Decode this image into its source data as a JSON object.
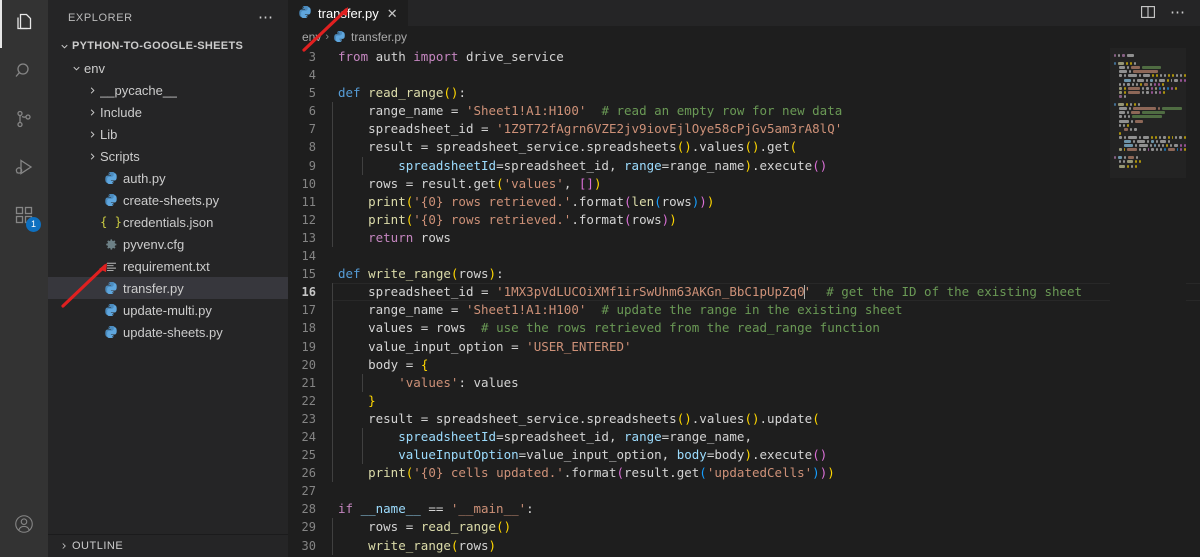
{
  "activitybar": {
    "items": [
      {
        "name": "explorer",
        "icon": "files-icon",
        "active": true,
        "badge": ""
      },
      {
        "name": "search",
        "icon": "search-icon",
        "active": false,
        "badge": ""
      },
      {
        "name": "source-control",
        "icon": "source-control-icon",
        "active": false,
        "badge": ""
      },
      {
        "name": "run-and-debug",
        "icon": "run-debug-icon",
        "active": false,
        "badge": ""
      },
      {
        "name": "extensions",
        "icon": "extensions-icon",
        "active": false,
        "badge": "1"
      }
    ],
    "accounts_icon": "account-icon"
  },
  "sidebar": {
    "title": "EXPLORER",
    "more_actions": "⋯",
    "root": {
      "label": "PYTHON-TO-GOOGLE-SHEETS",
      "expanded": true
    },
    "tree": [
      {
        "label": "env",
        "kind": "folder",
        "expanded": true,
        "indent": 1,
        "icon": "chevron-down-icon"
      },
      {
        "label": "__pycache__",
        "kind": "folder",
        "expanded": false,
        "indent": 2,
        "icon": "chevron-right-icon"
      },
      {
        "label": "Include",
        "kind": "folder",
        "expanded": false,
        "indent": 2,
        "icon": "chevron-right-icon"
      },
      {
        "label": "Lib",
        "kind": "folder",
        "expanded": false,
        "indent": 2,
        "icon": "chevron-right-icon"
      },
      {
        "label": "Scripts",
        "kind": "folder",
        "expanded": false,
        "indent": 2,
        "icon": "chevron-right-icon"
      },
      {
        "label": "auth.py",
        "kind": "python",
        "indent": 2,
        "icon": "python-file-icon"
      },
      {
        "label": "create-sheets.py",
        "kind": "python",
        "indent": 2,
        "icon": "python-file-icon"
      },
      {
        "label": "credentials.json",
        "kind": "json",
        "indent": 2,
        "icon": "json-file-icon"
      },
      {
        "label": "pyvenv.cfg",
        "kind": "config",
        "indent": 2,
        "icon": "gear-icon"
      },
      {
        "label": "requirement.txt",
        "kind": "text",
        "indent": 2,
        "icon": "text-file-icon"
      },
      {
        "label": "transfer.py",
        "kind": "python",
        "indent": 2,
        "icon": "python-file-icon",
        "selected": true
      },
      {
        "label": "update-multi.py",
        "kind": "python",
        "indent": 2,
        "icon": "python-file-icon"
      },
      {
        "label": "update-sheets.py",
        "kind": "python",
        "indent": 2,
        "icon": "python-file-icon"
      }
    ],
    "footer": {
      "label": "OUTLINE",
      "icon": "chevron-right-icon"
    }
  },
  "editor": {
    "tabs": [
      {
        "label": "transfer.py",
        "icon": "python-file-icon",
        "active": true,
        "close": "✕"
      }
    ],
    "actions": [
      {
        "name": "split-editor-right-button",
        "icon": "split-editor-icon"
      },
      {
        "name": "more-actions-button",
        "icon": "ellipsis-icon"
      }
    ],
    "breadcrumbs": [
      {
        "label": "env",
        "icon": ""
      },
      {
        "label": "transfer.py",
        "icon": "python-file-icon"
      }
    ],
    "breadcrumb_separator": "›",
    "active_line": 16,
    "first_visible_line": 3,
    "lines": [
      {
        "n": 3,
        "indent": 0,
        "tokens": [
          {
            "t": "from ",
            "c": "kctl"
          },
          {
            "t": "auth ",
            "c": "plain"
          },
          {
            "t": "import ",
            "c": "kctl"
          },
          {
            "t": "drive_service",
            "c": "plain"
          }
        ]
      },
      {
        "n": 4,
        "indent": 0,
        "tokens": []
      },
      {
        "n": 5,
        "indent": 0,
        "tokens": [
          {
            "t": "def ",
            "c": "k"
          },
          {
            "t": "read_range",
            "c": "fn"
          },
          {
            "t": "(",
            "c": "br0"
          },
          {
            "t": ")",
            "c": "br0"
          },
          {
            "t": ":",
            "c": "pun"
          }
        ]
      },
      {
        "n": 6,
        "indent": 1,
        "tokens": [
          {
            "t": "range_name ",
            "c": "plain"
          },
          {
            "t": "= ",
            "c": "op"
          },
          {
            "t": "'Sheet1!A1:H100'",
            "c": "str"
          },
          {
            "t": "  # read an empty row for new data",
            "c": "cmt"
          }
        ]
      },
      {
        "n": 7,
        "indent": 1,
        "tokens": [
          {
            "t": "spreadsheet_id ",
            "c": "plain"
          },
          {
            "t": "= ",
            "c": "op"
          },
          {
            "t": "'1Z9T72fAgrn6VZE2jv9iovEjlOye58cPjGv5am3rA8lQ'",
            "c": "str"
          }
        ]
      },
      {
        "n": 8,
        "indent": 1,
        "tokens": [
          {
            "t": "result ",
            "c": "plain"
          },
          {
            "t": "= ",
            "c": "op"
          },
          {
            "t": "spreadsheet_service",
            "c": "plain"
          },
          {
            "t": ".",
            "c": "pun"
          },
          {
            "t": "spreadsheets",
            "c": "plain"
          },
          {
            "t": "(",
            "c": "br0"
          },
          {
            "t": ")",
            "c": "br0"
          },
          {
            "t": ".",
            "c": "pun"
          },
          {
            "t": "values",
            "c": "plain"
          },
          {
            "t": "(",
            "c": "br0"
          },
          {
            "t": ")",
            "c": "br0"
          },
          {
            "t": ".",
            "c": "pun"
          },
          {
            "t": "get",
            "c": "plain"
          },
          {
            "t": "(",
            "c": "br0"
          }
        ]
      },
      {
        "n": 9,
        "indent": 2,
        "tokens": [
          {
            "t": "spreadsheetId",
            "c": "var"
          },
          {
            "t": "=",
            "c": "op"
          },
          {
            "t": "spreadsheet_id",
            "c": "plain"
          },
          {
            "t": ", ",
            "c": "pun"
          },
          {
            "t": "range",
            "c": "var"
          },
          {
            "t": "=",
            "c": "op"
          },
          {
            "t": "range_name",
            "c": "plain"
          },
          {
            "t": ")",
            "c": "br0"
          },
          {
            "t": ".",
            "c": "pun"
          },
          {
            "t": "execute",
            "c": "plain"
          },
          {
            "t": "(",
            "c": "br1"
          },
          {
            "t": ")",
            "c": "br1"
          }
        ]
      },
      {
        "n": 10,
        "indent": 1,
        "tokens": [
          {
            "t": "rows ",
            "c": "plain"
          },
          {
            "t": "= ",
            "c": "op"
          },
          {
            "t": "result",
            "c": "plain"
          },
          {
            "t": ".",
            "c": "pun"
          },
          {
            "t": "get",
            "c": "plain"
          },
          {
            "t": "(",
            "c": "br0"
          },
          {
            "t": "'values'",
            "c": "str"
          },
          {
            "t": ", ",
            "c": "pun"
          },
          {
            "t": "[",
            "c": "br1"
          },
          {
            "t": "]",
            "c": "br1"
          },
          {
            "t": ")",
            "c": "br0"
          }
        ]
      },
      {
        "n": 11,
        "indent": 1,
        "tokens": [
          {
            "t": "print",
            "c": "fn"
          },
          {
            "t": "(",
            "c": "br0"
          },
          {
            "t": "'{0} rows retrieved.'",
            "c": "str"
          },
          {
            "t": ".",
            "c": "pun"
          },
          {
            "t": "format",
            "c": "plain"
          },
          {
            "t": "(",
            "c": "br1"
          },
          {
            "t": "len",
            "c": "fn"
          },
          {
            "t": "(",
            "c": "br2"
          },
          {
            "t": "rows",
            "c": "plain"
          },
          {
            "t": ")",
            "c": "br2"
          },
          {
            "t": ")",
            "c": "br1"
          },
          {
            "t": ")",
            "c": "br0"
          }
        ]
      },
      {
        "n": 12,
        "indent": 1,
        "tokens": [
          {
            "t": "print",
            "c": "fn"
          },
          {
            "t": "(",
            "c": "br0"
          },
          {
            "t": "'{0} rows retrieved.'",
            "c": "str"
          },
          {
            "t": ".",
            "c": "pun"
          },
          {
            "t": "format",
            "c": "plain"
          },
          {
            "t": "(",
            "c": "br1"
          },
          {
            "t": "rows",
            "c": "plain"
          },
          {
            "t": ")",
            "c": "br1"
          },
          {
            "t": ")",
            "c": "br0"
          }
        ]
      },
      {
        "n": 13,
        "indent": 1,
        "tokens": [
          {
            "t": "return ",
            "c": "kctl"
          },
          {
            "t": "rows",
            "c": "plain"
          }
        ]
      },
      {
        "n": 14,
        "indent": 0,
        "tokens": []
      },
      {
        "n": 15,
        "indent": 0,
        "tokens": [
          {
            "t": "def ",
            "c": "k"
          },
          {
            "t": "write_range",
            "c": "fn"
          },
          {
            "t": "(",
            "c": "br0"
          },
          {
            "t": "rows",
            "c": "plain"
          },
          {
            "t": ")",
            "c": "br0"
          },
          {
            "t": ":",
            "c": "pun"
          }
        ]
      },
      {
        "n": 16,
        "indent": 1,
        "active": true,
        "tokens": [
          {
            "t": "spreadsheet_id ",
            "c": "plain"
          },
          {
            "t": "= ",
            "c": "op"
          },
          {
            "t": "'1MX3pVdLUCOiXMf1irSwUhm63AKGn_BbC1pUpZq0",
            "c": "str"
          },
          {
            "t": "|CURSOR|",
            "c": "cursor"
          },
          {
            "t": "'",
            "c": "str"
          },
          {
            "t": "  # get the ID of the existing sheet",
            "c": "cmt"
          }
        ]
      },
      {
        "n": 17,
        "indent": 1,
        "tokens": [
          {
            "t": "range_name ",
            "c": "plain"
          },
          {
            "t": "= ",
            "c": "op"
          },
          {
            "t": "'Sheet1!A1:H100'",
            "c": "str"
          },
          {
            "t": "  # update the range in the existing sheet",
            "c": "cmt"
          }
        ]
      },
      {
        "n": 18,
        "indent": 1,
        "tokens": [
          {
            "t": "values ",
            "c": "plain"
          },
          {
            "t": "= ",
            "c": "op"
          },
          {
            "t": "rows",
            "c": "plain"
          },
          {
            "t": "  # use the rows retrieved from the read_range function",
            "c": "cmt"
          }
        ]
      },
      {
        "n": 19,
        "indent": 1,
        "tokens": [
          {
            "t": "value_input_option ",
            "c": "plain"
          },
          {
            "t": "= ",
            "c": "op"
          },
          {
            "t": "'USER_ENTERED'",
            "c": "str"
          }
        ]
      },
      {
        "n": 20,
        "indent": 1,
        "tokens": [
          {
            "t": "body ",
            "c": "plain"
          },
          {
            "t": "= ",
            "c": "op"
          },
          {
            "t": "{",
            "c": "br0"
          }
        ]
      },
      {
        "n": 21,
        "indent": 2,
        "tokens": [
          {
            "t": "'values'",
            "c": "str"
          },
          {
            "t": ": ",
            "c": "pun"
          },
          {
            "t": "values",
            "c": "plain"
          }
        ]
      },
      {
        "n": 22,
        "indent": 1,
        "tokens": [
          {
            "t": "}",
            "c": "br0"
          }
        ]
      },
      {
        "n": 23,
        "indent": 1,
        "tokens": [
          {
            "t": "result ",
            "c": "plain"
          },
          {
            "t": "= ",
            "c": "op"
          },
          {
            "t": "spreadsheet_service",
            "c": "plain"
          },
          {
            "t": ".",
            "c": "pun"
          },
          {
            "t": "spreadsheets",
            "c": "plain"
          },
          {
            "t": "(",
            "c": "br0"
          },
          {
            "t": ")",
            "c": "br0"
          },
          {
            "t": ".",
            "c": "pun"
          },
          {
            "t": "values",
            "c": "plain"
          },
          {
            "t": "(",
            "c": "br0"
          },
          {
            "t": ")",
            "c": "br0"
          },
          {
            "t": ".",
            "c": "pun"
          },
          {
            "t": "update",
            "c": "plain"
          },
          {
            "t": "(",
            "c": "br0"
          }
        ]
      },
      {
        "n": 24,
        "indent": 2,
        "tokens": [
          {
            "t": "spreadsheetId",
            "c": "var"
          },
          {
            "t": "=",
            "c": "op"
          },
          {
            "t": "spreadsheet_id",
            "c": "plain"
          },
          {
            "t": ", ",
            "c": "pun"
          },
          {
            "t": "range",
            "c": "var"
          },
          {
            "t": "=",
            "c": "op"
          },
          {
            "t": "range_name",
            "c": "plain"
          },
          {
            "t": ",",
            "c": "pun"
          }
        ]
      },
      {
        "n": 25,
        "indent": 2,
        "tokens": [
          {
            "t": "valueInputOption",
            "c": "var"
          },
          {
            "t": "=",
            "c": "op"
          },
          {
            "t": "value_input_option",
            "c": "plain"
          },
          {
            "t": ", ",
            "c": "pun"
          },
          {
            "t": "body",
            "c": "var"
          },
          {
            "t": "=",
            "c": "op"
          },
          {
            "t": "body",
            "c": "plain"
          },
          {
            "t": ")",
            "c": "br0"
          },
          {
            "t": ".",
            "c": "pun"
          },
          {
            "t": "execute",
            "c": "plain"
          },
          {
            "t": "(",
            "c": "br1"
          },
          {
            "t": ")",
            "c": "br1"
          }
        ]
      },
      {
        "n": 26,
        "indent": 1,
        "tokens": [
          {
            "t": "print",
            "c": "fn"
          },
          {
            "t": "(",
            "c": "br0"
          },
          {
            "t": "'{0} cells updated.'",
            "c": "str"
          },
          {
            "t": ".",
            "c": "pun"
          },
          {
            "t": "format",
            "c": "plain"
          },
          {
            "t": "(",
            "c": "br1"
          },
          {
            "t": "result",
            "c": "plain"
          },
          {
            "t": ".",
            "c": "pun"
          },
          {
            "t": "get",
            "c": "plain"
          },
          {
            "t": "(",
            "c": "br2"
          },
          {
            "t": "'updatedCells'",
            "c": "str"
          },
          {
            "t": ")",
            "c": "br2"
          },
          {
            "t": ")",
            "c": "br1"
          },
          {
            "t": ")",
            "c": "br0"
          }
        ]
      },
      {
        "n": 27,
        "indent": 0,
        "tokens": []
      },
      {
        "n": 28,
        "indent": 0,
        "tokens": [
          {
            "t": "if ",
            "c": "kctl"
          },
          {
            "t": "__name__ ",
            "c": "var"
          },
          {
            "t": "== ",
            "c": "op"
          },
          {
            "t": "'__main__'",
            "c": "str"
          },
          {
            "t": ":",
            "c": "pun"
          }
        ]
      },
      {
        "n": 29,
        "indent": 1,
        "tokens": [
          {
            "t": "rows ",
            "c": "plain"
          },
          {
            "t": "= ",
            "c": "op"
          },
          {
            "t": "read_range",
            "c": "fn"
          },
          {
            "t": "(",
            "c": "br0"
          },
          {
            "t": ")",
            "c": "br0"
          }
        ]
      },
      {
        "n": 30,
        "indent": 1,
        "tokens": [
          {
            "t": "write_range",
            "c": "fn"
          },
          {
            "t": "(",
            "c": "br0"
          },
          {
            "t": "rows",
            "c": "plain"
          },
          {
            "t": ")",
            "c": "br0"
          }
        ]
      }
    ]
  },
  "colors": {
    "editor_bg": "#1e1e1e",
    "sidebar_bg": "#252526",
    "activitybar_bg": "#333333",
    "selection_bg": "#37373d",
    "badge_bg": "#0e70c0",
    "annotation_arrow": "#e02020",
    "keyword": "#569cd6",
    "control_keyword": "#c586c0",
    "function": "#dcdcaa",
    "string": "#ce9178",
    "comment": "#6a9955",
    "parameter": "#9cdcfe"
  },
  "annotations": [
    {
      "name": "arrow-to-tab",
      "color": "#e02020"
    },
    {
      "name": "arrow-to-transfer-file",
      "color": "#e02020"
    }
  ]
}
